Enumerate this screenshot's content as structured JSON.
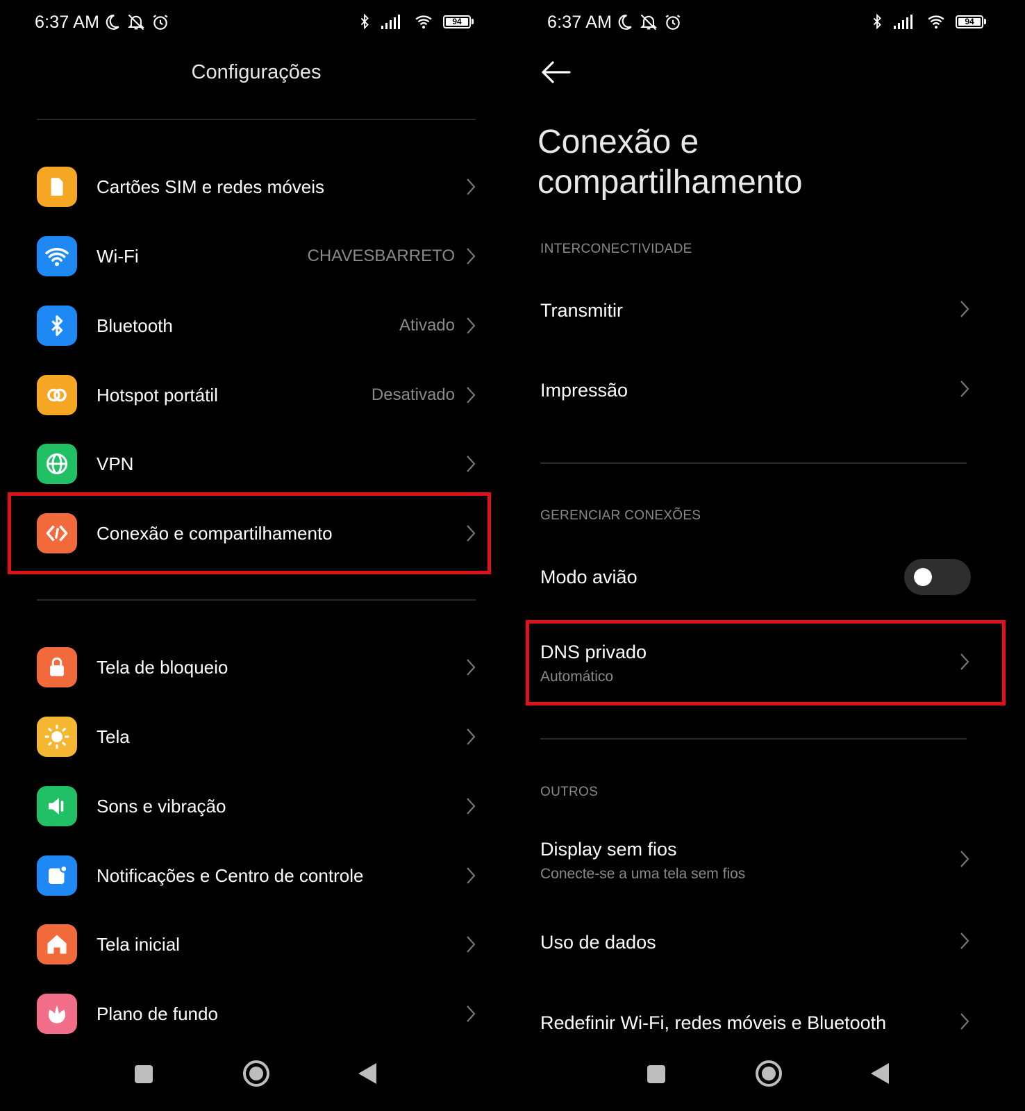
{
  "left": {
    "status": {
      "time": "6:37 AM",
      "battery": "94"
    },
    "title": "Configurações",
    "items": [
      {
        "label": "Cartões SIM e redes móveis",
        "value": ""
      },
      {
        "label": "Wi-Fi",
        "value": "CHAVESBARRETO"
      },
      {
        "label": "Bluetooth",
        "value": "Ativado"
      },
      {
        "label": "Hotspot portátil",
        "value": "Desativado"
      },
      {
        "label": "VPN",
        "value": ""
      },
      {
        "label": "Conexão e compartilhamento",
        "value": ""
      },
      {
        "label": "Tela de bloqueio",
        "value": ""
      },
      {
        "label": "Tela",
        "value": ""
      },
      {
        "label": "Sons e vibração",
        "value": ""
      },
      {
        "label": "Notificações e Centro de controle",
        "value": ""
      },
      {
        "label": "Tela inicial",
        "value": ""
      },
      {
        "label": "Plano de fundo",
        "value": ""
      }
    ]
  },
  "right": {
    "status": {
      "time": "6:37 AM",
      "battery": "94"
    },
    "title_line1": "Conexão e",
    "title_line2": "compartilhamento",
    "sections": {
      "interconnect": "INTERCONECTIVIDADE",
      "manage": "GERENCIAR CONEXÕES",
      "others": "OUTROS"
    },
    "items": {
      "transmit": "Transmitir",
      "print": "Impressão",
      "airplane": "Modo avião",
      "airplane_on": false,
      "dns": "DNS privado",
      "dns_sub": "Automático",
      "display": "Display sem fios",
      "display_sub": "Conecte-se a uma tela sem fios",
      "data_usage": "Uso de dados",
      "reset": "Redefinir Wi-Fi, redes móveis e Bluetooth"
    }
  },
  "colors": {
    "highlight": "#e0111b",
    "sim": "#f5a623",
    "wifi": "#1e88f5",
    "bluetooth": "#1e88f5",
    "hotspot": "#f5a623",
    "vpn": "#21c064",
    "connection": "#f26a3b",
    "lock": "#f26a3b",
    "display": "#f5b731",
    "sound": "#21c064",
    "notifications": "#1e88f5",
    "home": "#f26a3b",
    "wallpaper": "#f26d87"
  }
}
